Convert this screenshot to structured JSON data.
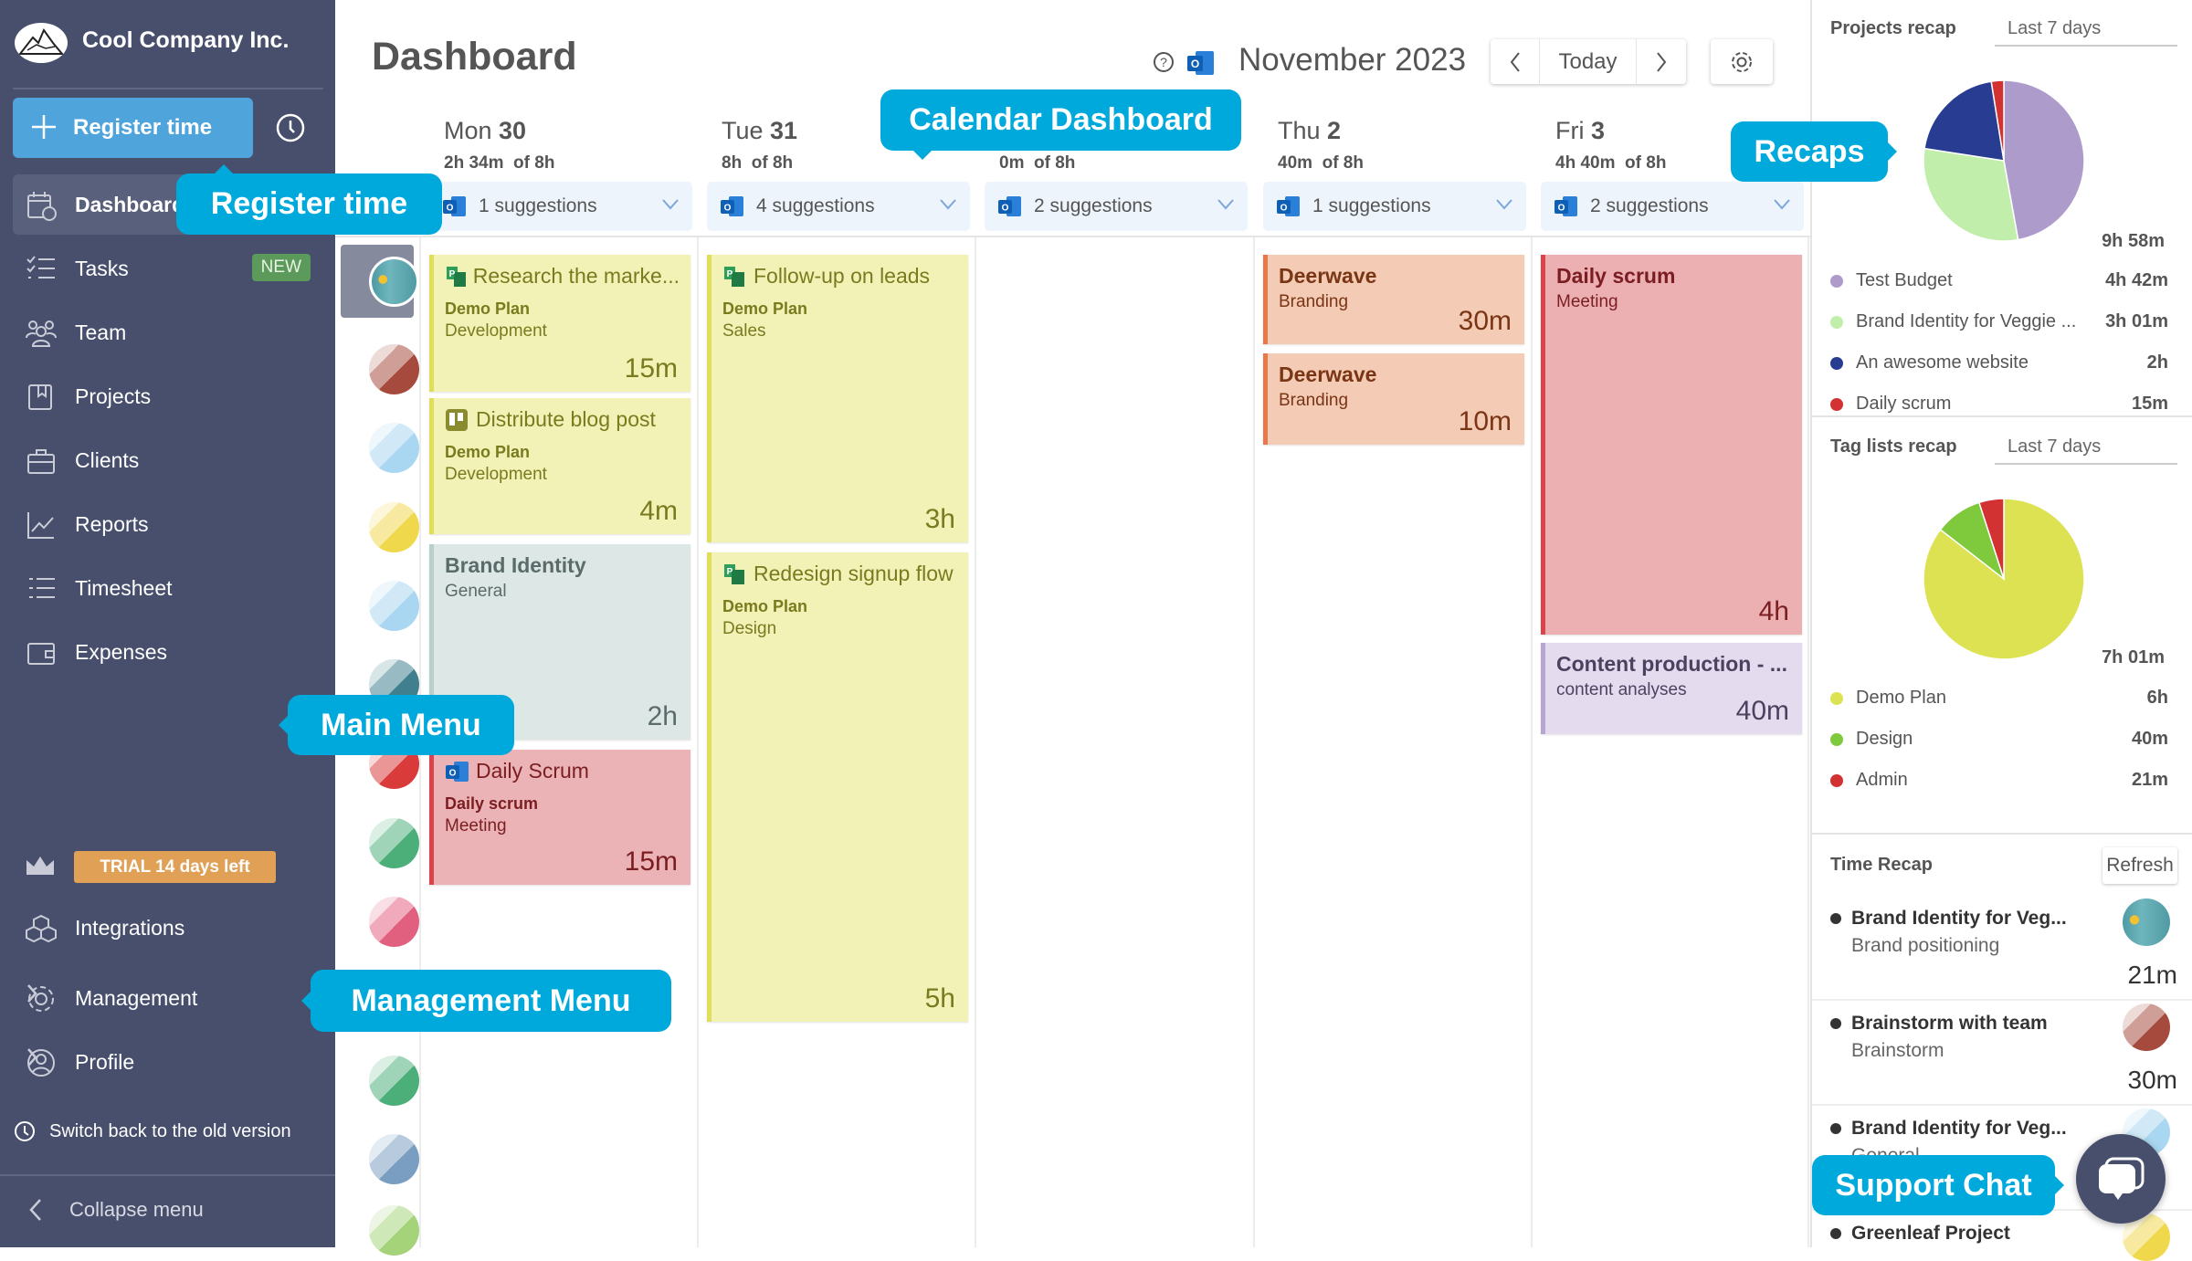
{
  "sidebar": {
    "company": "Cool Company Inc.",
    "register_label": "Register time",
    "items": [
      {
        "label": "Dashboard",
        "icon": "calendar-clock-icon",
        "active": true
      },
      {
        "label": "Tasks",
        "icon": "checklist-icon",
        "badge": "NEW"
      },
      {
        "label": "Team",
        "icon": "team-icon"
      },
      {
        "label": "Projects",
        "icon": "projects-icon"
      },
      {
        "label": "Clients",
        "icon": "briefcase-icon"
      },
      {
        "label": "Reports",
        "icon": "chart-icon"
      },
      {
        "label": "Timesheet",
        "icon": "timesheet-icon"
      },
      {
        "label": "Expenses",
        "icon": "wallet-icon"
      }
    ],
    "trial": "TRIAL 14 days left",
    "integrations": "Integrations",
    "management": "Management",
    "profile": "Profile",
    "switch_back": "Switch back to the old version",
    "collapse": "Collapse menu"
  },
  "header": {
    "title": "Dashboard",
    "month": "November 2023",
    "today": "Today"
  },
  "days": [
    {
      "name": "Mon",
      "num": "30",
      "hours": "2h 34m  of 8h",
      "suggestions": "1 suggestions"
    },
    {
      "name": "Tue",
      "num": "31",
      "hours": "8h  of 8h",
      "suggestions": "4 suggestions"
    },
    {
      "name": "",
      "num": "",
      "hours": "0m  of 8h",
      "suggestions": "2 suggestions"
    },
    {
      "name": "Thu",
      "num": "2",
      "hours": "40m  of 8h",
      "suggestions": "1 suggestions"
    },
    {
      "name": "Fri",
      "num": "3",
      "hours": "4h 40m  of 8h",
      "suggestions": "2 suggestions"
    }
  ],
  "events": [
    {
      "day": 0,
      "title": "Research the marke...",
      "plan": "Demo Plan",
      "tag": "Development",
      "duration": "15m",
      "icon": "planner-icon",
      "bg": "#f2f2b7",
      "border": "#dede5c",
      "fg": "#7a7a1e"
    },
    {
      "day": 0,
      "title": "Distribute blog post",
      "plan": "Demo Plan",
      "tag": "Development",
      "duration": "4m",
      "icon": "trello-icon",
      "bg": "#f2f2b7",
      "border": "#dede5c",
      "fg": "#7a7a1e"
    },
    {
      "day": 0,
      "title": "Brand Identity",
      "plan": "",
      "tag": "General",
      "duration": "2h",
      "icon": "",
      "bg": "#dde8e6",
      "border": "#b9cfcc",
      "fg": "#5a6b69"
    },
    {
      "day": 0,
      "title": "Daily Scrum",
      "plan": "Daily scrum",
      "tag": "Meeting",
      "duration": "15m",
      "icon": "outlook-icon",
      "bg": "#ecb3b6",
      "border": "#d9434b",
      "fg": "#7a1e22"
    },
    {
      "day": 1,
      "title": "Follow-up on leads",
      "plan": "Demo Plan",
      "tag": "Sales",
      "duration": "3h",
      "icon": "planner-icon",
      "bg": "#f2f2b7",
      "border": "#dede5c",
      "fg": "#7a7a1e"
    },
    {
      "day": 1,
      "title": "Redesign signup flow",
      "plan": "Demo Plan",
      "tag": "Design",
      "duration": "5h",
      "icon": "planner-icon",
      "bg": "#f2f2b7",
      "border": "#dede5c",
      "fg": "#7a7a1e"
    },
    {
      "day": 3,
      "title": "Deerwave",
      "plan": "",
      "tag": "Branding",
      "duration": "30m",
      "icon": "",
      "bg": "#f4cbb5",
      "border": "#e8774a",
      "fg": "#7a3515"
    },
    {
      "day": 3,
      "title": "Deerwave",
      "plan": "",
      "tag": "Branding",
      "duration": "10m",
      "icon": "",
      "bg": "#f4cbb5",
      "border": "#e8774a",
      "fg": "#7a3515"
    },
    {
      "day": 4,
      "title": "Daily scrum",
      "plan": "",
      "tag": "Meeting",
      "duration": "4h",
      "icon": "",
      "bg": "#ecb0b3",
      "border": "#d9434b",
      "fg": "#7a1e22"
    },
    {
      "day": 4,
      "title": "Content production - ...",
      "plan": "",
      "tag": "content analyses",
      "duration": "40m",
      "icon": "",
      "bg": "#e4dcee",
      "border": "#b7a6d3",
      "fg": "#4d4160"
    }
  ],
  "projects_recap": {
    "title": "Projects recap",
    "period": "Last 7 days",
    "total": "9h 58m",
    "items": [
      {
        "name": "Test Budget",
        "value": "4h 42m",
        "minutes": 282,
        "color": "#ad9ccb"
      },
      {
        "name": "Brand Identity for Veggie ...",
        "value": "3h 01m",
        "minutes": 181,
        "color": "#c2eeab"
      },
      {
        "name": "An awesome website",
        "value": "2h",
        "minutes": 120,
        "color": "#283d92"
      },
      {
        "name": "Daily scrum",
        "value": "15m",
        "minutes": 15,
        "color": "#d23232"
      }
    ]
  },
  "tag_recap": {
    "title": "Tag lists recap",
    "period": "Last 7 days",
    "total": "7h 01m",
    "items": [
      {
        "name": "Demo Plan",
        "value": "6h",
        "minutes": 360,
        "color": "#dde253"
      },
      {
        "name": "Design",
        "value": "40m",
        "minutes": 40,
        "color": "#7fc93c"
      },
      {
        "name": "Admin",
        "value": "21m",
        "minutes": 21,
        "color": "#d23232"
      }
    ]
  },
  "time_recap": {
    "title": "Time Recap",
    "refresh": "Refresh",
    "items": [
      {
        "name": "Brand Identity for Veg...",
        "sub": "Brand positioning",
        "duration": "21m",
        "avatar": "photo"
      },
      {
        "name": "Brainstorm with team",
        "sub": "Brainstorm",
        "duration": "30m",
        "avatar": "#a54a3c"
      },
      {
        "name": "Brand Identity for Veg...",
        "sub": "General",
        "duration": "",
        "avatar": "#a9d6f0"
      },
      {
        "name": "Greenleaf Project",
        "sub": "",
        "duration": "",
        "avatar": "#f0d84c"
      }
    ]
  },
  "avatars": [
    "photo",
    "#a54a3c",
    "#a9d6f0",
    "#f0d84c",
    "#a9d6f0",
    "#3f7f8e",
    "#d93a3a",
    "#4caf7a",
    "#e2607f",
    "#4caf7a",
    "#7a9ec2",
    "#a5d37a"
  ],
  "callouts": {
    "calendar": "Calendar Dashboard",
    "recaps": "Recaps",
    "register": "Register time",
    "main_menu": "Main Menu",
    "management": "Management Menu",
    "support": "Support Chat"
  },
  "colors": {
    "sidebar": "#474f6d",
    "accent": "#00a9dc",
    "register": "#4fa4dc"
  }
}
